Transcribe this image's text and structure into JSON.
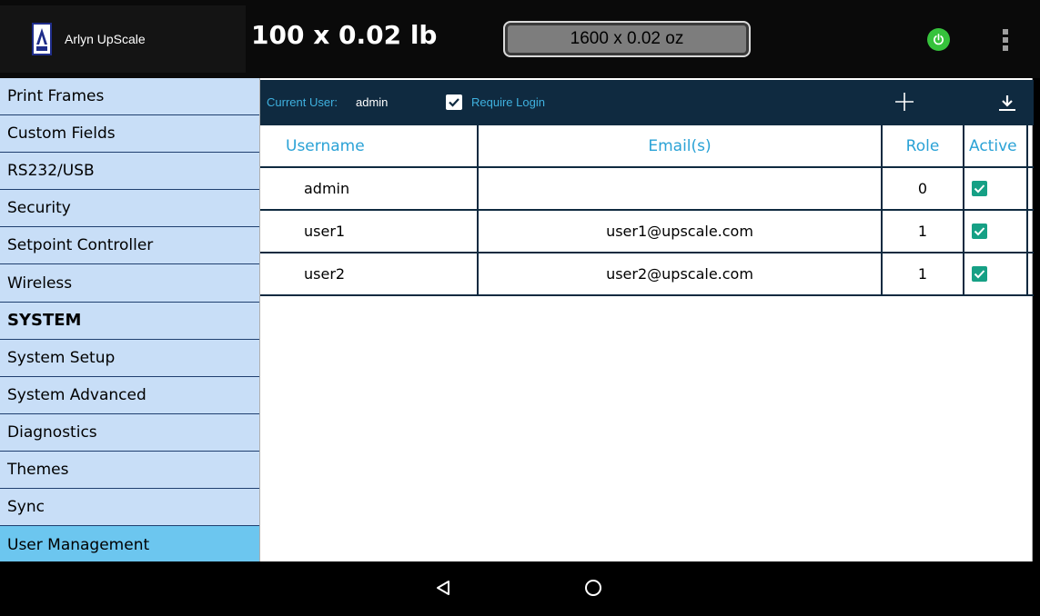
{
  "app": {
    "name": "Arlyn UpScale"
  },
  "header": {
    "weight_main": "100 x 0.02 lb",
    "weight_alt": "1600 x 0.02 oz",
    "power_icon": "power-icon",
    "menu_icon": "overflow-menu-icon",
    "power_color": "#36c23c"
  },
  "sidebar": {
    "items": [
      {
        "label": "Print Frames",
        "header": false,
        "active": false
      },
      {
        "label": "Custom Fields",
        "header": false,
        "active": false
      },
      {
        "label": "RS232/USB",
        "header": false,
        "active": false
      },
      {
        "label": "Security",
        "header": false,
        "active": false
      },
      {
        "label": "Setpoint Controller",
        "header": false,
        "active": false
      },
      {
        "label": "Wireless",
        "header": false,
        "active": false
      },
      {
        "label": "SYSTEM",
        "header": true,
        "active": false
      },
      {
        "label": "System Setup",
        "header": false,
        "active": false
      },
      {
        "label": "System Advanced",
        "header": false,
        "active": false
      },
      {
        "label": "Diagnostics",
        "header": false,
        "active": false
      },
      {
        "label": "Themes",
        "header": false,
        "active": false
      },
      {
        "label": "Sync",
        "header": false,
        "active": false
      },
      {
        "label": "User Management",
        "header": false,
        "active": true
      }
    ],
    "active_color": "#6cc6ef"
  },
  "toolbar": {
    "current_user_label": "Current User:",
    "current_user_value": "admin",
    "require_login_label": "Require Login",
    "require_login_checked": true,
    "add_icon": "plus-icon",
    "download_icon": "download-icon"
  },
  "table": {
    "columns": [
      "Username",
      "Email(s)",
      "Role",
      "Active"
    ],
    "rows": [
      {
        "username": "admin",
        "email": "",
        "role": "0",
        "active": true
      },
      {
        "username": "user1",
        "email": "user1@upscale.com",
        "role": "1",
        "active": true
      },
      {
        "username": "user2",
        "email": "user2@upscale.com",
        "role": "1",
        "active": true
      }
    ],
    "header_color": "#2aa2d6",
    "check_color": "#16a085"
  },
  "navbar": {
    "back_icon": "back-triangle-icon",
    "home_icon": "home-circle-icon"
  }
}
